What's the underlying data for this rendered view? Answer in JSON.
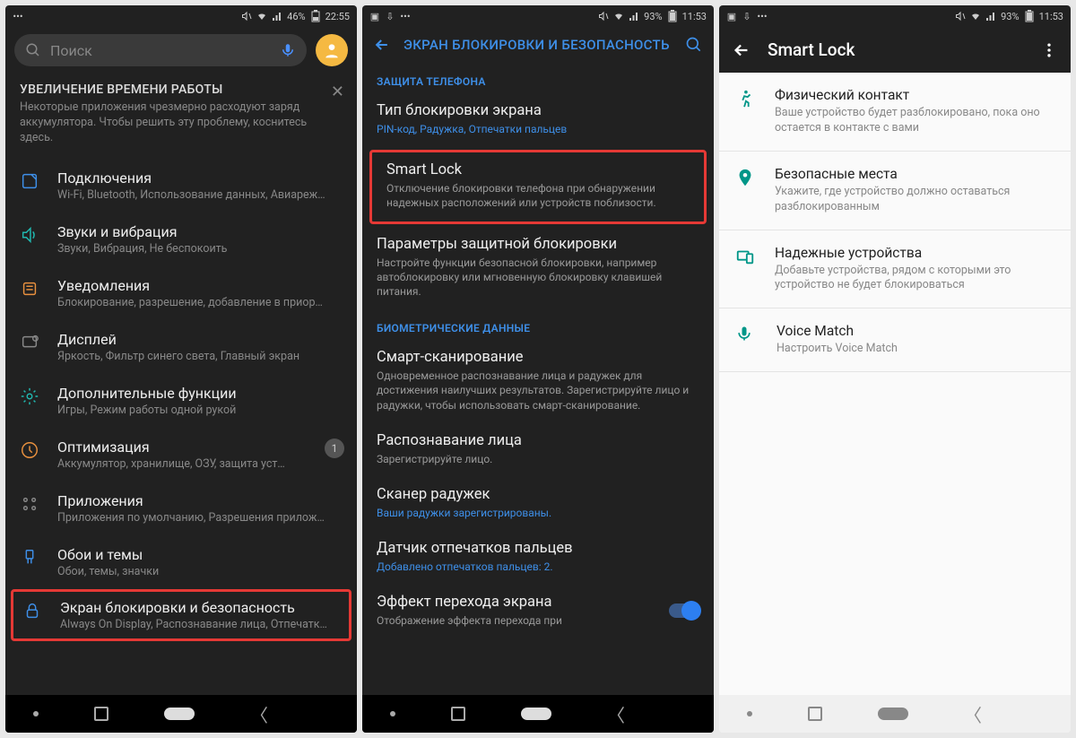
{
  "screen1": {
    "status": {
      "battery": "46%",
      "time": "22:55"
    },
    "search_placeholder": "Поиск",
    "notice": {
      "title": "УВЕЛИЧЕНИЕ ВРЕМЕНИ РАБОТЫ",
      "sub": "Некоторые приложения чрезмерно расходуют заряд аккумулятора. Чтобы решить эту проблему, коснитесь здесь."
    },
    "items": [
      {
        "title": "Подключения",
        "sub": "Wi-Fi, Bluetooth, Использование данных, Авиареж…"
      },
      {
        "title": "Звуки и вибрация",
        "sub": "Звуки, Вибрация, Не беспокоить"
      },
      {
        "title": "Уведомления",
        "sub": "Блокирование, разрешение, добавление в приор…"
      },
      {
        "title": "Дисплей",
        "sub": "Яркость, Фильтр синего света, Главный экран"
      },
      {
        "title": "Дополнительные функции",
        "sub": "Игры, Режим работы одной рукой"
      },
      {
        "title": "Оптимизация",
        "sub": "Аккумулятор, хранилище, ОЗУ, защита уст…",
        "badge": "1"
      },
      {
        "title": "Приложения",
        "sub": "Приложения по умолчанию, Разрешения прилож…"
      },
      {
        "title": "Обои и темы",
        "sub": "Обои, темы, значки"
      },
      {
        "title": "Экран блокировки и безопасность",
        "sub": "Always On Display, Распознавание лица, Отпечатк…"
      }
    ]
  },
  "screen2": {
    "status": {
      "battery": "93%",
      "time": "11:53"
    },
    "header": "ЭКРАН БЛОКИРОВКИ И БЕЗОПАСНОСТЬ",
    "section1": "ЗАЩИТА ТЕЛЕФОНА",
    "items1": [
      {
        "title": "Тип блокировки экрана",
        "sub": "PIN-код, Радужка, Отпечатки пальцев",
        "link": true
      },
      {
        "title": "Smart Lock",
        "sub": "Отключение блокировки телефона при обнаружении надежных расположений или устройств поблизости.",
        "highlight": true
      },
      {
        "title": "Параметры защитной блокировки",
        "sub": "Настройте функции безопасной блокировки, например автоблокировку или мгновенную блокировку клавишей питания."
      }
    ],
    "section2": "БИОМЕТРИЧЕСКИЕ ДАННЫЕ",
    "items2": [
      {
        "title": "Смарт-сканирование",
        "sub": "Одновременное распознавание лица и радужек для достижения наилучших результатов. Зарегистрируйте лицо и радужки, чтобы использовать смарт-сканирование."
      },
      {
        "title": "Распознавание лица",
        "sub": "Зарегистрируйте лицо."
      },
      {
        "title": "Сканер радужек",
        "sub": "Ваши радужки зарегистрированы.",
        "link": true
      },
      {
        "title": "Датчик отпечатков пальцев",
        "sub": "Добавлено отпечатков пальцев: 2.",
        "link": true
      },
      {
        "title": "Эффект перехода экрана",
        "sub": "Отображение эффекта перехода при",
        "toggle": true
      }
    ]
  },
  "screen3": {
    "status": {
      "battery": "93%",
      "time": "11:53"
    },
    "header": "Smart Lock",
    "items": [
      {
        "title": "Физический контакт",
        "sub": "Ваше устройство будет разблокировано, пока оно остается в контакте с вами"
      },
      {
        "title": "Безопасные места",
        "sub": "Укажите, где устройство должно оставаться разблокированным"
      },
      {
        "title": "Надежные устройства",
        "sub": "Добавьте устройства, рядом с которыми это устройство не будет блокироваться"
      },
      {
        "title": "Voice Match",
        "sub": "Настроить Voice Match"
      }
    ]
  }
}
